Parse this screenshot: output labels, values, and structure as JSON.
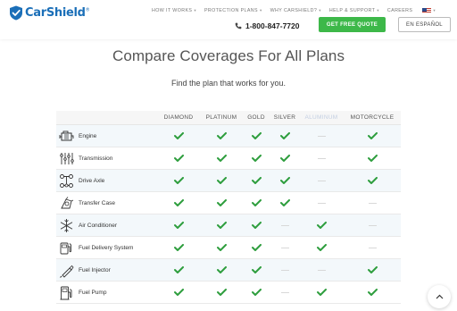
{
  "header": {
    "logo_text": "CarShield",
    "logo_tm": "®",
    "nav": [
      {
        "label": "HOW IT WORKS",
        "chevron": true
      },
      {
        "label": "PROTECTION PLANS",
        "chevron": true
      },
      {
        "label": "WHY CARSHIELD?",
        "chevron": true
      },
      {
        "label": "HELP & SUPPORT",
        "chevron": true
      },
      {
        "label": "CAREERS",
        "chevron": false
      }
    ],
    "phone": "1-800-847-7720",
    "quote_button": "GET FREE QUOTE",
    "language_button": "EN ESPAÑOL"
  },
  "page": {
    "title": "Compare Coverages For All Plans",
    "subtitle": "Find the plan that works for you."
  },
  "table": {
    "plans": [
      "DIAMOND",
      "PLATINUM",
      "GOLD",
      "SILVER",
      "ALUMINUM",
      "MOTORCYCLE"
    ],
    "faded_plan_index": 4,
    "rows": [
      {
        "feature": "Engine",
        "icon": "engine-icon",
        "coverage": [
          true,
          true,
          true,
          true,
          false,
          true
        ]
      },
      {
        "feature": "Transmission",
        "icon": "transmission-icon",
        "coverage": [
          true,
          true,
          true,
          true,
          false,
          true
        ]
      },
      {
        "feature": "Drive Axle",
        "icon": "drive-axle-icon",
        "coverage": [
          true,
          true,
          true,
          true,
          false,
          true
        ]
      },
      {
        "feature": "Transfer Case",
        "icon": "transfer-case-icon",
        "coverage": [
          true,
          true,
          true,
          true,
          false,
          false
        ]
      },
      {
        "feature": "Air Conditioner",
        "icon": "snowflake-icon",
        "coverage": [
          true,
          true,
          true,
          false,
          true,
          false
        ]
      },
      {
        "feature": "Fuel Delivery System",
        "icon": "fuel-delivery-icon",
        "coverage": [
          true,
          true,
          true,
          false,
          true,
          false
        ]
      },
      {
        "feature": "Fuel Injector",
        "icon": "fuel-injector-icon",
        "coverage": [
          true,
          true,
          true,
          false,
          false,
          true
        ]
      },
      {
        "feature": "Fuel Pump",
        "icon": "fuel-pump-icon",
        "coverage": [
          true,
          true,
          true,
          false,
          true,
          true
        ]
      }
    ]
  },
  "colors": {
    "brand_blue": "#1b6fb8",
    "check_green": "#2e9e3e",
    "button_green": "#3db849"
  }
}
